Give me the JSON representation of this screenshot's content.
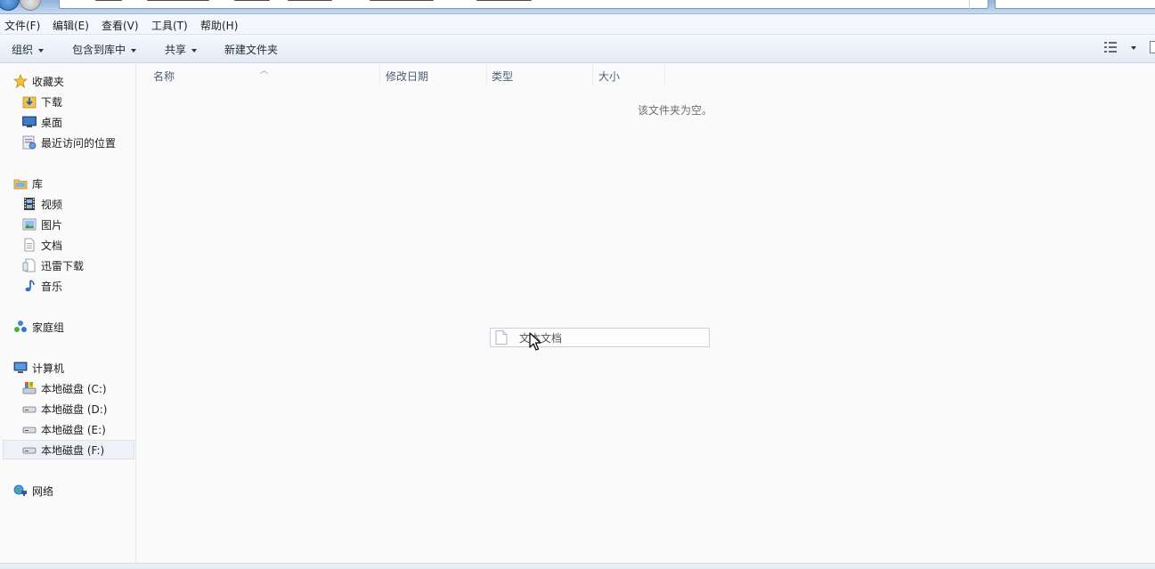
{
  "menubar": {
    "file": "文件(F)",
    "edit": "编辑(E)",
    "view": "查看(V)",
    "tools": "工具(T)",
    "help": "帮助(H)"
  },
  "toolbar": {
    "organize": "组织",
    "include_in_library": "包含到库中",
    "share": "共享",
    "new_folder": "新建文件夹"
  },
  "sidebar": {
    "favorites": {
      "label": "收藏夹",
      "items": [
        {
          "label": "下载",
          "icon": "downloads-icon"
        },
        {
          "label": "桌面",
          "icon": "desktop-icon"
        },
        {
          "label": "最近访问的位置",
          "icon": "recent-places-icon"
        }
      ]
    },
    "libraries": {
      "label": "库",
      "items": [
        {
          "label": "视频",
          "icon": "video-icon"
        },
        {
          "label": "图片",
          "icon": "pictures-icon"
        },
        {
          "label": "文档",
          "icon": "documents-icon"
        },
        {
          "label": "迅雷下载",
          "icon": "xunlei-download-icon"
        },
        {
          "label": "音乐",
          "icon": "music-icon"
        }
      ]
    },
    "homegroup": {
      "label": "家庭组"
    },
    "computer": {
      "label": "计算机",
      "drives": [
        {
          "label": "本地磁盘 (C:)",
          "icon": "system-drive-icon"
        },
        {
          "label": "本地磁盘 (D:)",
          "icon": "drive-icon"
        },
        {
          "label": "本地磁盘 (E:)",
          "icon": "drive-icon"
        },
        {
          "label": "本地磁盘 (F:)",
          "icon": "drive-icon",
          "selected": true
        }
      ]
    },
    "network": {
      "label": "网络"
    }
  },
  "columns": {
    "name": "名称",
    "date_modified": "修改日期",
    "type": "类型",
    "size": "大小"
  },
  "content": {
    "empty_message": "该文件夹为空。",
    "drag_item_label": "文本文档"
  },
  "colors": {
    "accent": "#1e5fae",
    "folder_yellow": "#f2c24f",
    "header_text": "#4c607a"
  }
}
